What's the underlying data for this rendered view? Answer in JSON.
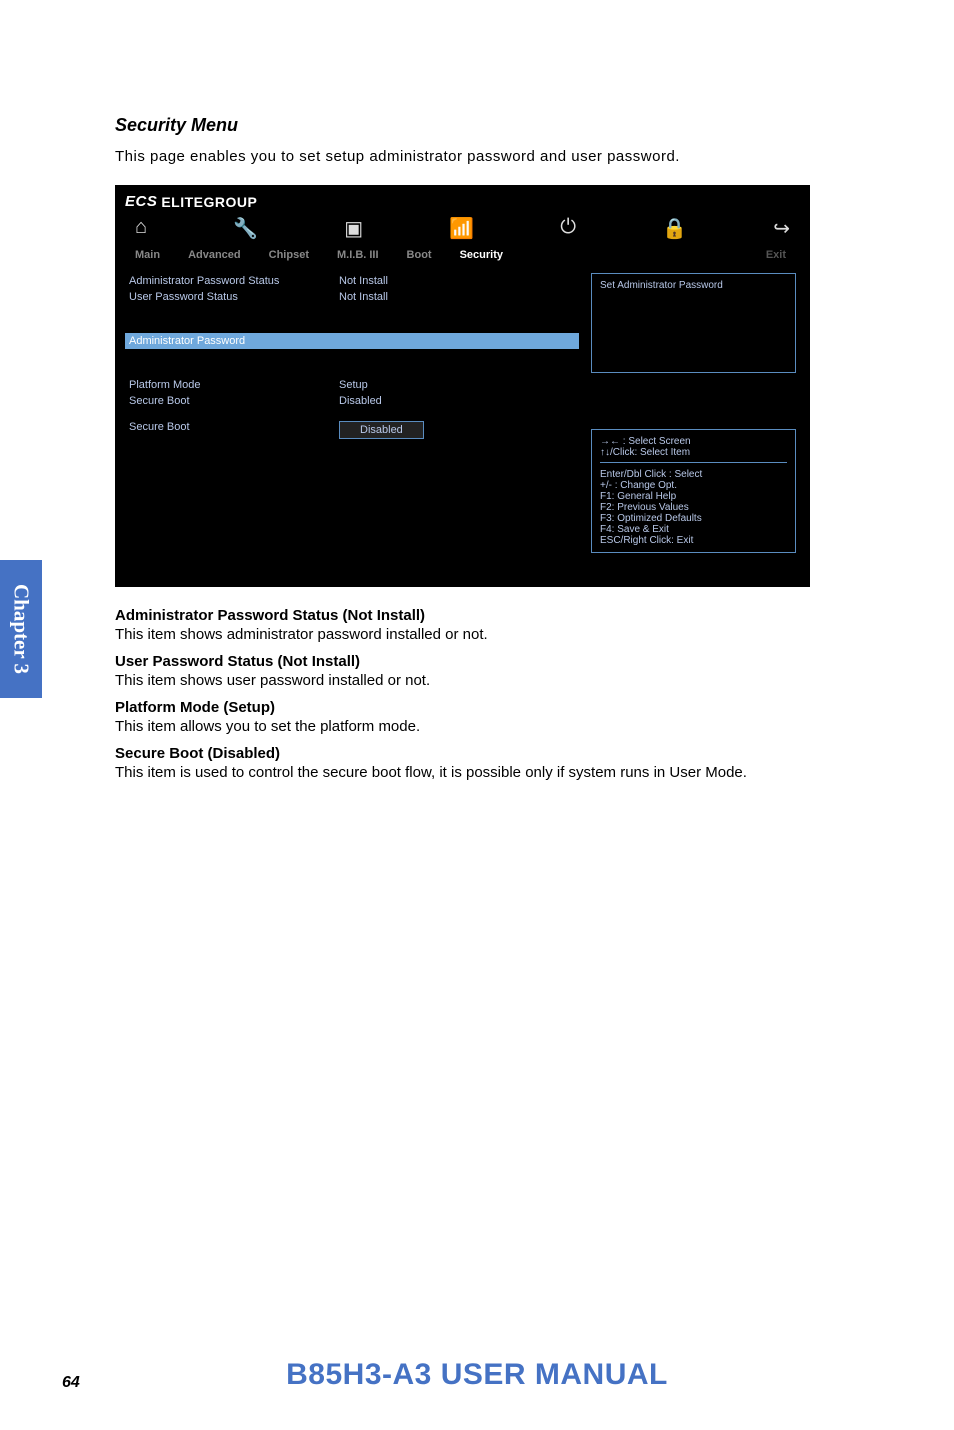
{
  "section_title": "Security Menu",
  "intro_text": "This page enables you to set setup administrator password and user password.",
  "bios": {
    "brand": "ELITEGROUP",
    "brand_prefix": "ECS",
    "tabs": {
      "main": "Main",
      "advanced": "Advanced",
      "chipset": "Chipset",
      "mib": "M.I.B. III",
      "boot": "Boot",
      "security": "Security",
      "exit": "Exit"
    },
    "left": {
      "admin_pw_status_label": "Administrator Password Status",
      "admin_pw_status_value": "Not Install",
      "user_pw_status_label": "User Password Status",
      "user_pw_status_value": "Not Install",
      "admin_password_label": "Administrator  Password",
      "platform_mode_label": "Platform Mode",
      "platform_mode_value": "Setup",
      "secure_boot1_label": "Secure Boot",
      "secure_boot1_value": "Disabled",
      "secure_boot2_label": "Secure Boot",
      "secure_boot2_button": "Disabled"
    },
    "right": {
      "top_help": "Set Administrator Password",
      "bottom_help": {
        "l1": "→←   : Select Screen",
        "l2": "↑↓/Click: Select Item",
        "l3": "Enter/Dbl Click : Select",
        "l4": "+/- : Change Opt.",
        "l5": "F1: General Help",
        "l6": "F2: Previous Values",
        "l7": "F3: Optimized Defaults",
        "l8": "F4: Save & Exit",
        "l9": "ESC/Right Click: Exit"
      }
    }
  },
  "sections": {
    "s1_heading": "Administrator Password Status (Not Install)",
    "s1_text": "This item shows administrator password installed or not.",
    "s2_heading": "User Password Status (Not Install)",
    "s2_text": "This item shows user password installed or not.",
    "s3_heading": "Platform Mode (Setup)",
    "s3_text": "This item allows you to set the platform mode.",
    "s4_heading": "Secure Boot (Disabled)",
    "s4_text": "This item is used to control the secure boot flow, it is possible only if system runs in User Mode."
  },
  "chapter_tab": "Chapter 3",
  "footer_title": "B85H3-A3 USER MANUAL",
  "page_number": "64"
}
